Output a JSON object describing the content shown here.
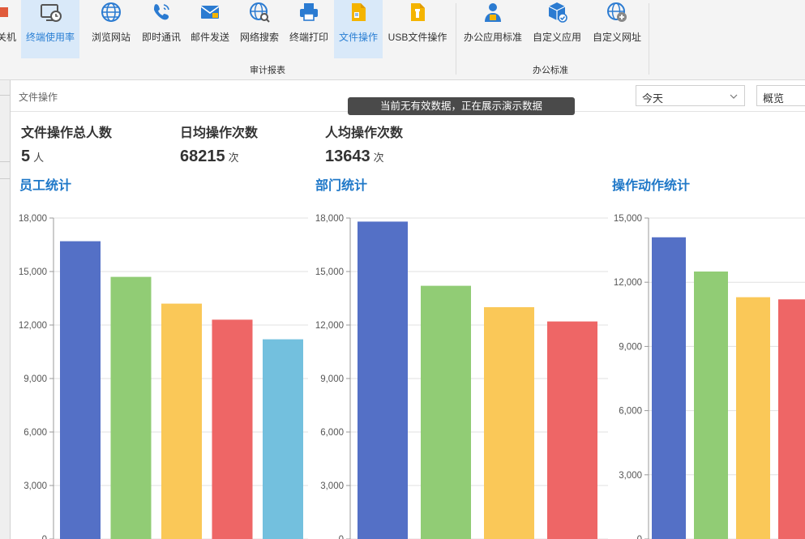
{
  "ribbon": {
    "buttons": [
      {
        "id": "shutdown",
        "label": "关机",
        "icon": "power-icon"
      },
      {
        "id": "terminal-usage",
        "label": "终端使用率",
        "icon": "monitor-clock-icon",
        "active": true
      },
      {
        "id": "browse",
        "label": "浏览网站",
        "icon": "globe-icon"
      },
      {
        "id": "im",
        "label": "即时通讯",
        "icon": "phone-icon"
      },
      {
        "id": "mail",
        "label": "邮件发送",
        "icon": "mail-icon"
      },
      {
        "id": "search",
        "label": "网络搜索",
        "icon": "globe-search-icon"
      },
      {
        "id": "print",
        "label": "终端打印",
        "icon": "printer-icon"
      },
      {
        "id": "file-op",
        "label": "文件操作",
        "icon": "file-icon",
        "active": true
      },
      {
        "id": "usb-file-op",
        "label": "USB文件操作",
        "icon": "usb-file-icon"
      },
      {
        "id": "office-std",
        "label": "办公应用标准",
        "icon": "user-badge-icon"
      },
      {
        "id": "custom-app",
        "label": "自定义应用",
        "icon": "cube-check-icon"
      },
      {
        "id": "custom-url",
        "label": "自定义网址",
        "icon": "globe-add-icon"
      }
    ],
    "groups": [
      {
        "label": "审计报表"
      },
      {
        "label": "办公标准"
      }
    ]
  },
  "header": {
    "title": "文件操作",
    "date_select": "今天",
    "view_select": "概览",
    "toast": "当前无有效数据，正在展示演示数据"
  },
  "stats": [
    {
      "label": "文件操作总人数",
      "value": "5",
      "unit": "人"
    },
    {
      "label": "日均操作次数",
      "value": "68215",
      "unit": "次"
    },
    {
      "label": "人均操作次数",
      "value": "13643",
      "unit": "次"
    }
  ],
  "colors": {
    "accent": "#1f78c8",
    "series": [
      "#5470c6",
      "#91cc75",
      "#fac858",
      "#ee6666",
      "#73c0de"
    ]
  },
  "chart_data": [
    {
      "type": "bar",
      "title": "员工统计",
      "values": [
        16700,
        14700,
        13200,
        12300,
        11200
      ],
      "ylim": [
        0,
        18000
      ],
      "yticks": [
        0,
        3000,
        6000,
        9000,
        12000,
        15000,
        18000
      ],
      "ytick_labels": [
        "0",
        "3,000",
        "6,000",
        "9,000",
        "12,000",
        "15,000",
        "18,000"
      ],
      "grid": true
    },
    {
      "type": "bar",
      "title": "部门统计",
      "values": [
        17800,
        14200,
        13000,
        12200
      ],
      "ylim": [
        0,
        18000
      ],
      "yticks": [
        0,
        3000,
        6000,
        9000,
        12000,
        15000,
        18000
      ],
      "ytick_labels": [
        "0",
        "3,000",
        "6,000",
        "9,000",
        "12,000",
        "15,000",
        "18,000"
      ],
      "grid": true
    },
    {
      "type": "bar",
      "title": "操作动作统计",
      "values": [
        14100,
        12500,
        11300,
        11200
      ],
      "ylim": [
        0,
        15000
      ],
      "yticks": [
        0,
        3000,
        6000,
        9000,
        12000,
        15000
      ],
      "ytick_labels": [
        "0",
        "3,000",
        "6,000",
        "9,000",
        "12,000",
        "15,000"
      ],
      "grid": true
    }
  ]
}
